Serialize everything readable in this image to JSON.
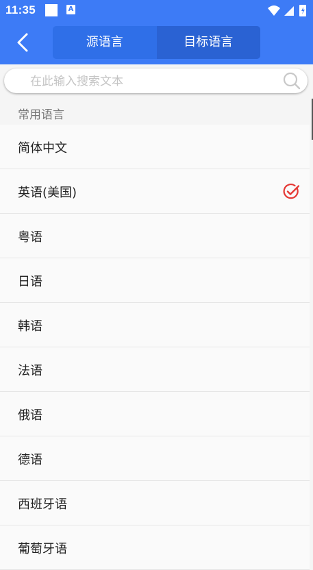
{
  "status_bar": {
    "time": "11:35",
    "notif_letter": "A"
  },
  "header": {
    "tabs": [
      {
        "label": "源语言",
        "active": false
      },
      {
        "label": "目标语言",
        "active": true
      }
    ]
  },
  "search": {
    "placeholder": "在此输入搜索文本",
    "value": ""
  },
  "section": {
    "title": "常用语言"
  },
  "languages": [
    {
      "label": "简体中文",
      "selected": false
    },
    {
      "label": "英语(美国)",
      "selected": true
    },
    {
      "label": "粤语",
      "selected": false
    },
    {
      "label": "日语",
      "selected": false
    },
    {
      "label": "韩语",
      "selected": false
    },
    {
      "label": "法语",
      "selected": false
    },
    {
      "label": "俄语",
      "selected": false
    },
    {
      "label": "德语",
      "selected": false
    },
    {
      "label": "西班牙语",
      "selected": false
    },
    {
      "label": "葡萄牙语",
      "selected": false
    }
  ],
  "colors": {
    "primary": "#3d7bf6",
    "tab_bg": "#2f6fe8",
    "tab_active": "#2a62d3",
    "check": "#e53935"
  },
  "icons": {
    "back": "back-arrow-icon",
    "search": "search-icon",
    "check": "check-circle-icon"
  }
}
